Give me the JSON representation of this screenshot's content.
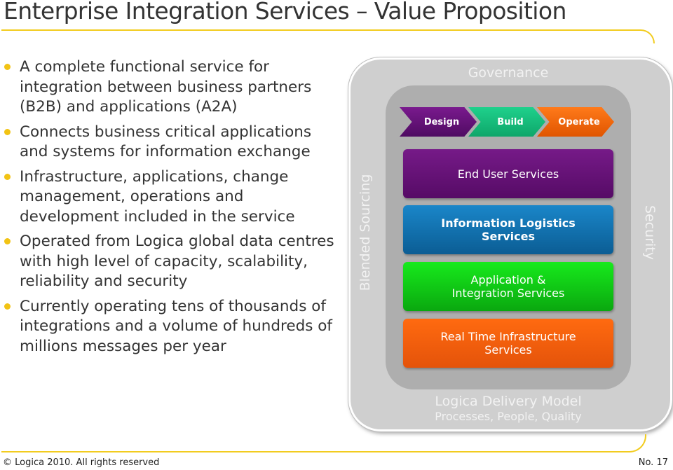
{
  "slide": {
    "title": "Enterprise Integration Services – Value Proposition",
    "bullets": [
      "A complete functional service for integration between business partners (B2B) and applications (A2A)",
      "Connects business critical applications and systems for information exchange",
      "Infrastructure, applications, change management, operations and development included in the service",
      "Operated from Logica global data centres with high level of capacity, scalability, reliability and security",
      "Currently operating tens of thousands of integrations and a volume of hundreds of millions messages per year"
    ],
    "footer": {
      "copyright": "© Logica 2010. All rights reserved",
      "page_number": "No. 17"
    },
    "accent_color": "#f2cc1f"
  },
  "diagram": {
    "governance_label": "Governance",
    "left_label": "Blended Sourcing",
    "right_label": "Security",
    "bottom_label": "Logica Delivery Model",
    "bottom_sublabel": "Processes, People, Quality",
    "phases": [
      {
        "label": "Design",
        "color": "#6a1480"
      },
      {
        "label": "Build",
        "color": "#17c07c"
      },
      {
        "label": "Operate",
        "color": "#f56a0c"
      }
    ],
    "layers": [
      {
        "label": "End User Services",
        "color": "#661279"
      },
      {
        "label": "Information Logistics Services",
        "color": "#1474b3"
      },
      {
        "label": "Application & Integration Services",
        "color": "#12cc17"
      },
      {
        "label": "Real Time Infrastructure Services",
        "color": "#f5600d"
      }
    ]
  }
}
